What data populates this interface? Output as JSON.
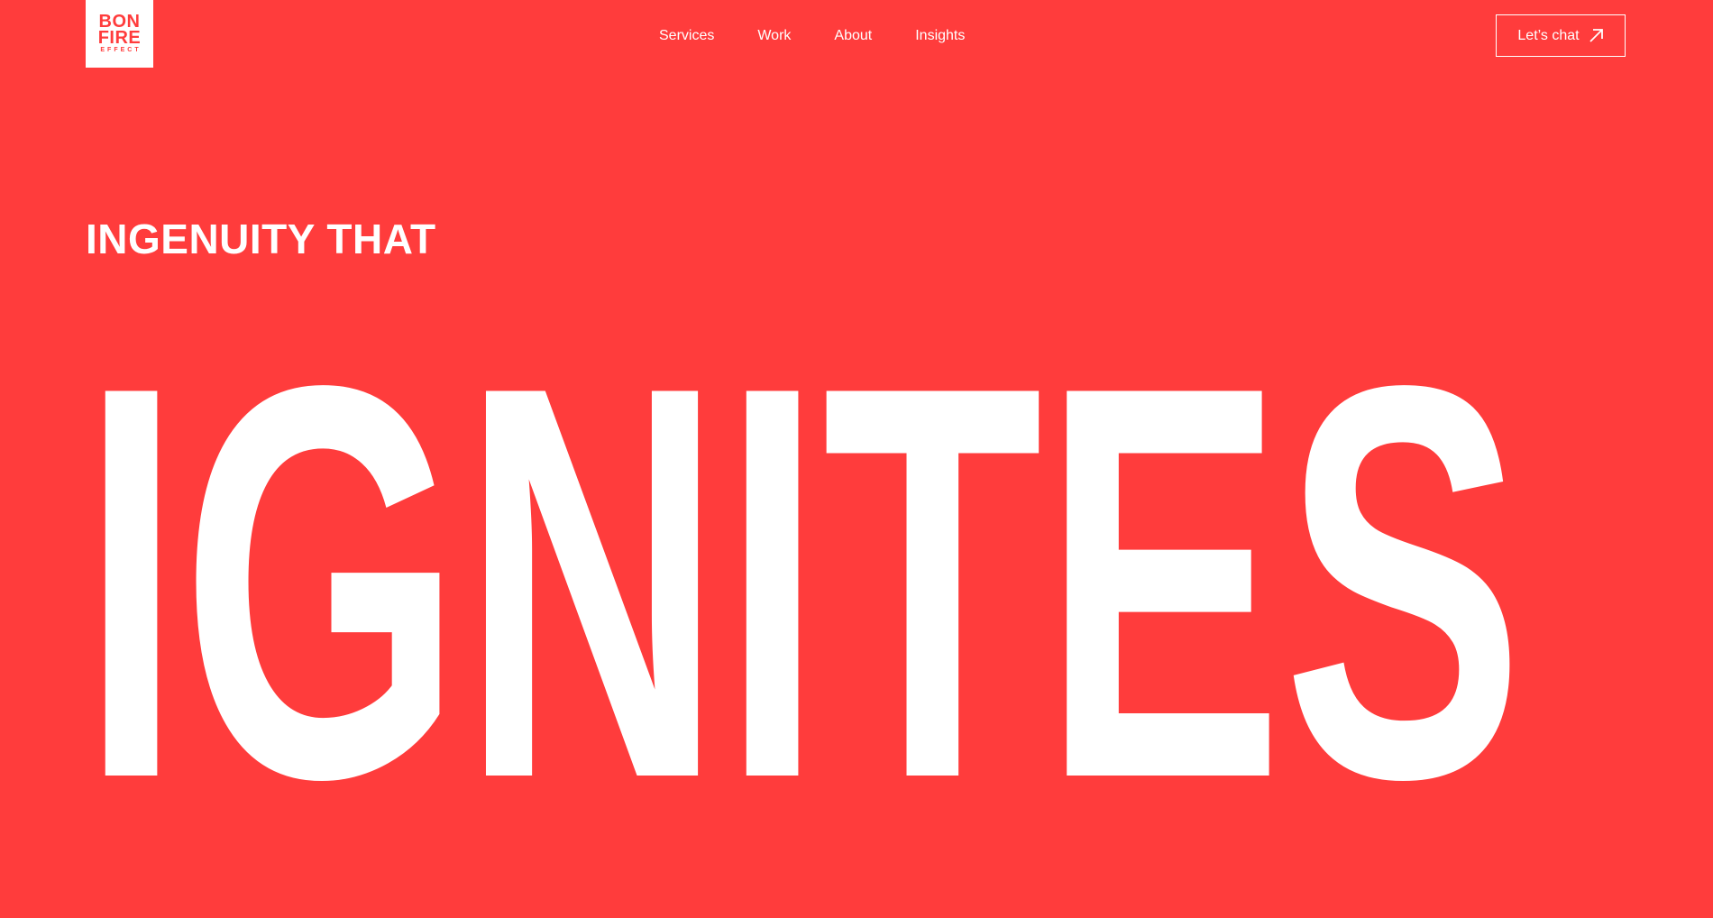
{
  "brand": {
    "logo_line1": "BON",
    "logo_line2": "FIRE",
    "logo_line3": "EFFECT",
    "background_color": "#FF3C3C",
    "text_color": "#FFFFFF"
  },
  "nav": {
    "items": [
      {
        "label": "Services"
      },
      {
        "label": "Work"
      },
      {
        "label": "About"
      },
      {
        "label": "Insights"
      }
    ]
  },
  "cta": {
    "label": "Let’s chat",
    "icon": "arrow-up-right-icon"
  },
  "hero": {
    "eyebrow": "INGENUITY THAT",
    "headline": "IGNITES"
  }
}
